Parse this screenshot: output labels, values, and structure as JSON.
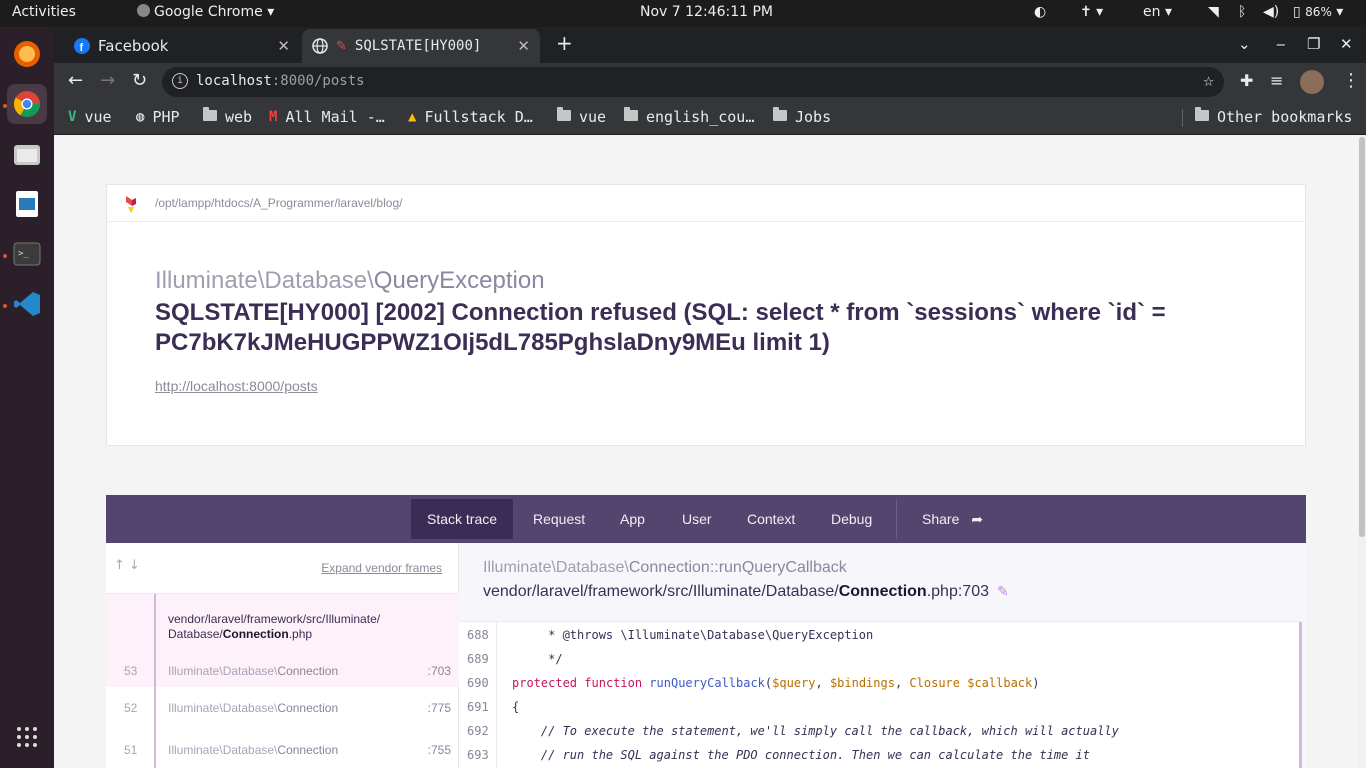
{
  "topbar": {
    "activities": "Activities",
    "app_menu": "Google Chrome",
    "clock": "Nov 7  12:46:11 PM",
    "lang": "en",
    "battery": "86%"
  },
  "browser": {
    "tabs": [
      {
        "title": "Facebook",
        "icon": "facebook-icon",
        "active": false
      },
      {
        "title": "SQLSTATE[HY000]",
        "icon": "globe-icon",
        "active": true
      }
    ],
    "address": {
      "host": "localhost",
      "rest": ":8000/posts"
    },
    "bookmarks": [
      {
        "label": "vue",
        "icon": "vue-icon"
      },
      {
        "label": "PHP",
        "icon": "globe-icon"
      },
      {
        "label": "web",
        "icon": "folder-icon"
      },
      {
        "label": "All Mail -…",
        "icon": "gmail-icon"
      },
      {
        "label": "Fullstack D…",
        "icon": "drive-icon"
      },
      {
        "label": "vue",
        "icon": "folder-icon"
      },
      {
        "label": "english_cou…",
        "icon": "folder-icon"
      },
      {
        "label": "Jobs",
        "icon": "folder-icon"
      }
    ],
    "other_bookmarks": "Other bookmarks"
  },
  "error": {
    "app_path": "/opt/lampp/htdocs/A_Programmer/laravel/blog/",
    "class_prefix": "Illuminate\\Database\\",
    "class_name": "QueryException",
    "message": "SQLSTATE[HY000] [2002] Connection refused (SQL: select * from `sessions` where `id` = PC7bK7kJMeHUGPPWZ1OIj5dL785PghslaDny9MEu limit 1)",
    "url": "http://localhost:8000/posts"
  },
  "tabs": [
    "Stack trace",
    "Request",
    "App",
    "User",
    "Context",
    "Debug"
  ],
  "share": "Share",
  "stack": {
    "expand": "Expand vendor frames",
    "frames": [
      {
        "num": "53",
        "file_dir": "vendor/laravel/framework/src/Illuminate/",
        "file_dir2": "Database/",
        "file_name": "Connection",
        "file_ext": ".php",
        "cls_prefix": "Illuminate\\Database\\",
        "cls": "Connection",
        "line": ":703"
      },
      {
        "num": "52",
        "cls_prefix": "Illuminate\\Database\\",
        "cls": "Connection",
        "line": ":775"
      },
      {
        "num": "51",
        "cls_prefix": "Illuminate\\Database\\",
        "cls": "Connection",
        "line": ":755"
      }
    ]
  },
  "detail": {
    "fn_prefix": "Illuminate\\Database\\",
    "fn_class": "Connection",
    "fn_method": "::runQueryCallback",
    "path_dir": "vendor/laravel/framework/src/Illuminate/Database/",
    "path_file": "Connection",
    "path_ext": ".php:703"
  },
  "code": [
    {
      "ln": "688",
      "text": "     * @throws \\Illuminate\\Database\\QueryException"
    },
    {
      "ln": "689",
      "text": "     */"
    },
    {
      "ln": "690",
      "text": "protected function runQueryCallback($query, $bindings, Closure $callback)"
    },
    {
      "ln": "691",
      "text": "{"
    },
    {
      "ln": "692",
      "text": "    // To execute the statement, we'll simply call the callback, which will actually"
    },
    {
      "ln": "693",
      "text": "    // run the SQL against the PDO connection. Then we can calculate the time it"
    }
  ]
}
